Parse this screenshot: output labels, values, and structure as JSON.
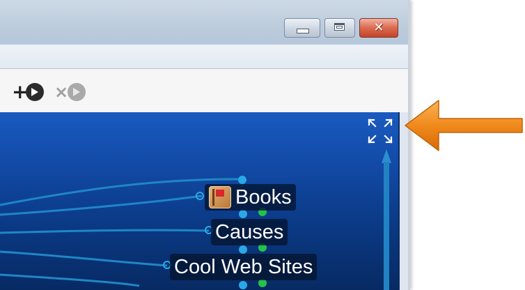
{
  "window": {
    "buttons": [
      "minimize",
      "maximize",
      "close"
    ]
  },
  "toolbar": {
    "add_link_icon": "add-thought-link-icon",
    "remove_link_icon": "remove-thought-link-icon"
  },
  "canvas": {
    "expand_icon": "expand-fullscreen-icon",
    "thoughts": [
      {
        "label": "Books",
        "icon": "book-icon"
      },
      {
        "label": "Causes"
      },
      {
        "label": "Cool Web Sites"
      }
    ]
  },
  "colors": {
    "canvas_top": "#1a5ac0",
    "canvas_bottom": "#072a63",
    "link_color": "#2a8fd0",
    "gate_blue": "#2aa9e8",
    "gate_green": "#25c24a",
    "callout_arrow": "#f08a1c"
  }
}
